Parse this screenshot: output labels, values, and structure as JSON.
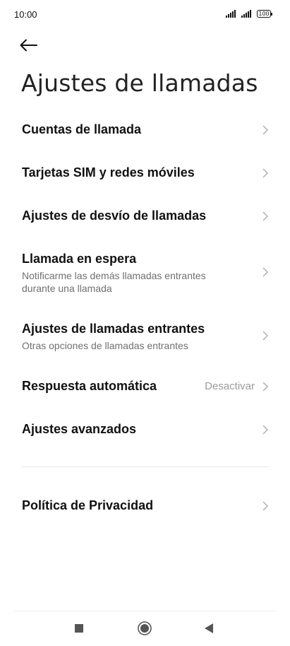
{
  "status_bar": {
    "time": "10:00",
    "battery_level": "100",
    "icons": [
      "signal-icon",
      "signal-icon",
      "battery-icon"
    ]
  },
  "header": {
    "back_icon": "arrow-left-icon",
    "title": "Ajustes de llamadas"
  },
  "items": [
    {
      "label": "Cuentas de llamada",
      "subtitle": "",
      "value": ""
    },
    {
      "label": "Tarjetas SIM y redes móviles",
      "subtitle": "",
      "value": ""
    },
    {
      "label": "Ajustes de desvío de llamadas",
      "subtitle": "",
      "value": ""
    },
    {
      "label": "Llamada en espera",
      "subtitle": "Notificarme las demás llamadas entrantes durante una llamada",
      "value": ""
    },
    {
      "label": "Ajustes de llamadas entrantes",
      "subtitle": "Otras opciones de llamadas entrantes",
      "value": ""
    },
    {
      "label": "Respuesta automática",
      "subtitle": "",
      "value": "Desactivar"
    },
    {
      "label": "Ajustes avanzados",
      "subtitle": "",
      "value": ""
    }
  ],
  "privacy": {
    "label": "Política de Privacidad"
  },
  "nav_bar": {
    "icons": [
      "recents-square-icon",
      "home-circle-icon",
      "back-triangle-icon"
    ]
  },
  "colors": {
    "background": "#ffffff",
    "text_primary": "#111111",
    "text_secondary": "#707070",
    "value_text": "#9a9a9a",
    "chevron": "#b0b0b0"
  }
}
